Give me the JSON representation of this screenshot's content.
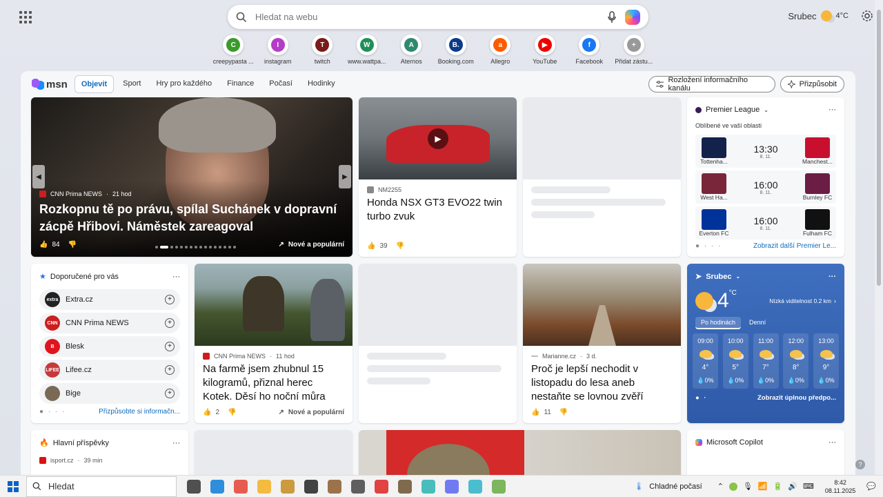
{
  "search": {
    "placeholder": "Hledat na webu"
  },
  "weather_top": {
    "city": "Srubec",
    "temp": "4°C"
  },
  "quick_links": [
    {
      "label": "creepypasta ...",
      "letter": "C",
      "color": "#3a9a2a"
    },
    {
      "label": "instagram",
      "letter": "I",
      "color": "#b43cc6"
    },
    {
      "label": "twitch",
      "letter": "T",
      "color": "#7a1a1a"
    },
    {
      "label": "www.wattpa...",
      "letter": "W",
      "color": "#1f8f5a"
    },
    {
      "label": "Aternos",
      "letter": "A",
      "color": "#2e8a6e"
    },
    {
      "label": "Booking.com",
      "letter": "B.",
      "color": "#0c3b8a"
    },
    {
      "label": "Allegro",
      "letter": "a",
      "color": "#ff5a00"
    },
    {
      "label": "YouTube",
      "letter": "▶",
      "color": "#e00"
    },
    {
      "label": "Facebook",
      "letter": "f",
      "color": "#1877f2"
    },
    {
      "label": "Přidat zástu...",
      "letter": "+",
      "color": "#999"
    }
  ],
  "nav": {
    "logo": "msn",
    "tabs": [
      "Objevit",
      "Sport",
      "Hry pro každého",
      "Finance",
      "Počasí",
      "Hodinky"
    ],
    "layout_btn": "Rozložení informačního kanálu",
    "customize_btn": "Přizpůsobit"
  },
  "hero": {
    "source": "CNN Prima NEWS",
    "time": "21 hod",
    "title": "Rozkopnu tě po právu, spílal Suchánek v dopravní zácpě Hřibovi. Náměstek zareagoval",
    "likes": "84",
    "tag": "Nové a populární"
  },
  "honda": {
    "source": "NM2255",
    "title": "Honda NSX GT3 EVO22 twin turbo zvuk",
    "likes": "39"
  },
  "premier": {
    "title": "Premier League",
    "subtitle": "Oblíbené ve vaší oblasti",
    "matches": [
      {
        "home": "Tottenha...",
        "away": "Manchest...",
        "time": "13:30",
        "date": "8. 11."
      },
      {
        "home": "West Ha...",
        "away": "Burnley FC",
        "time": "16:00",
        "date": "8. 11."
      },
      {
        "home": "Everton FC",
        "away": "Fulham FC",
        "time": "16:00",
        "date": "8. 11."
      }
    ],
    "more": "Zobrazit další Premier Le..."
  },
  "recommended": {
    "title": "Doporučené pro vás",
    "items": [
      {
        "name": "Extra.cz",
        "abbr": "extra",
        "color": "#222"
      },
      {
        "name": "CNN Prima NEWS",
        "abbr": "CNN",
        "color": "#cc1e1e"
      },
      {
        "name": "Blesk",
        "abbr": "B",
        "color": "#e0141e"
      },
      {
        "name": "Lifee.cz",
        "abbr": "LIFEE",
        "color": "#c43a3a"
      },
      {
        "name": "Bige",
        "abbr": "",
        "color": "#7a6a55"
      }
    ],
    "more": "Přizpůsobte si informačn..."
  },
  "kotek": {
    "source": "CNN Prima NEWS",
    "time": "11 hod",
    "title": "Na farmě jsem zhubnul 15 kilogramů, přiznal herec Kotek. Děsí ho noční můra",
    "likes": "2",
    "tag": "Nové a populární"
  },
  "forest": {
    "source": "Marianne.cz",
    "time": "3 d.",
    "title": "Proč je lepší nechodit v listopadu do lesa aneb nestaňte se lovnou zvěří",
    "likes": "11"
  },
  "weather": {
    "city": "Srubec",
    "temp": "4",
    "unit": "°C",
    "desc": "Nízká viditelnost 0.2 km",
    "tabs": [
      "Po hodinách",
      "Denní"
    ],
    "hours": [
      {
        "time": "09:00",
        "temp": "4°",
        "rain": "0%"
      },
      {
        "time": "10:00",
        "temp": "5°",
        "rain": "0%"
      },
      {
        "time": "11:00",
        "temp": "7°",
        "rain": "0%"
      },
      {
        "time": "12:00",
        "temp": "8°",
        "rain": "0%"
      },
      {
        "time": "13:00",
        "temp": "9°",
        "rain": "0%"
      }
    ],
    "more": "Zobrazit úplnou předpo..."
  },
  "top_posts": {
    "title": "Hlavní příspěvky",
    "source": "isport.cz",
    "time": "39 min"
  },
  "copilot": {
    "title": "Microsoft Copilot"
  },
  "taskbar": {
    "search": "Hledat",
    "weather": "Chladné počasí",
    "time": "8:42",
    "date": "08.11.2025"
  }
}
